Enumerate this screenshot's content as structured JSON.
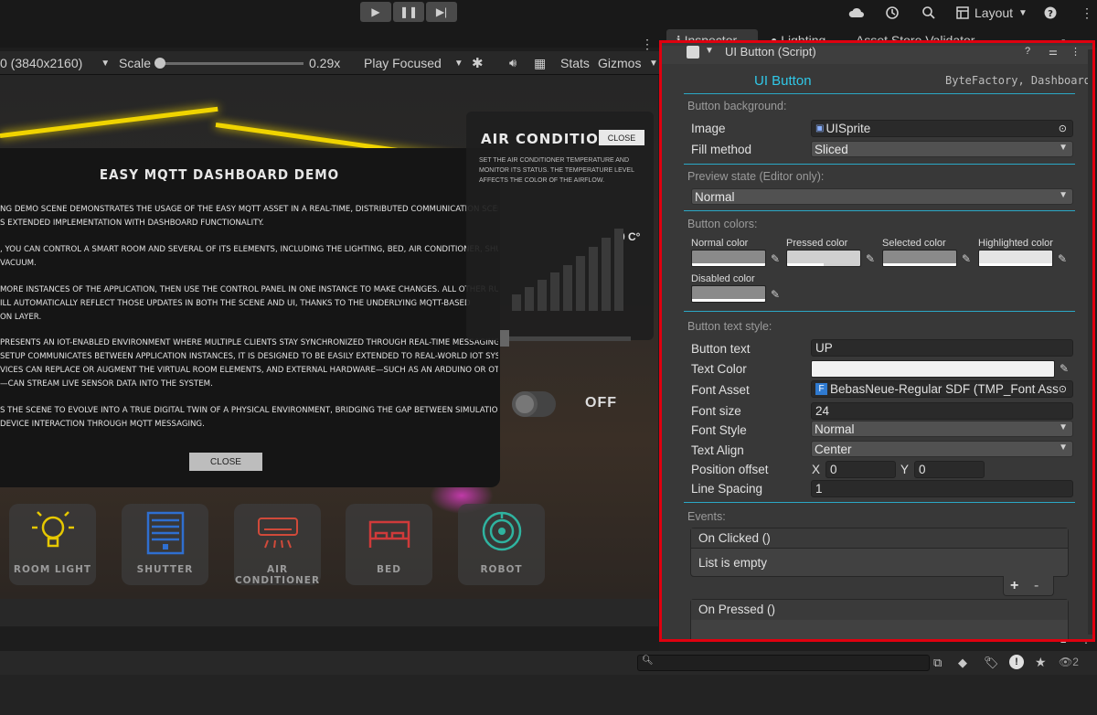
{
  "topbar": {
    "play_icon": "play-icon",
    "pause_icon": "pause-icon",
    "step_icon": "step-icon",
    "layout_label": "Layout"
  },
  "tabs": {
    "inspector": "Inspector",
    "lighting": "Lighting",
    "asset_store": "Asset Store Validator"
  },
  "game_toolbar": {
    "resolution": "0 (3840x2160)",
    "scale_label": "Scale",
    "scale_value": "0.29x",
    "play_mode": "Play Focused",
    "stats": "Stats",
    "gizmos": "Gizmos"
  },
  "game": {
    "dialog_title": "EASY MQTT DASHBOARD DEMO",
    "paragraphs": [
      "ng demo scene demonstrates the usage of the Easy MQTT asset in a real-time, distributed communication scenario,",
      "s extended implementation with dashboard functionality.",
      ", you can control a smart room and several of its elements, including the lighting, bed, air conditioner, shutters,",
      "vacuum.",
      "more instances of the application, then use the control panel in one instance to make changes. All other running",
      "ill automatically reflect those updates in both the scene and UI, thanks to the underlying MQTT-based",
      "on layer.",
      "presents an IoT-enabled environment where multiple clients stay synchronized through real-time messaging. While",
      "setup communicates between application instances, it is designed to be easily extended to real-world IoT systems.",
      "vices can replace or augment the virtual room elements, and external hardware—such as an Arduino or other IoT",
      "—can stream live sensor data into the system.",
      "s the scene to evolve into a true digital twin of a physical environment, bridging the gap between simulation and",
      "device interaction through MQTT messaging."
    ],
    "dialog_close": "CLOSE",
    "ac_title": "AIR CONDITIONER",
    "ac_close": "CLOSE",
    "ac_desc": "Set the air conditioner temperature and monitor its status. The temperature level affects the color of the airflow.",
    "ac_temp": "0 C°",
    "toggle_label": "OFF",
    "dock": [
      {
        "label": "ROOM LIGHT",
        "icon": "lightbulb-icon",
        "color": "#e6c800"
      },
      {
        "label": "SHUTTER",
        "icon": "shutter-icon",
        "color": "#2f6fd0"
      },
      {
        "label": "AIR CONDITIONER",
        "icon": "air-conditioner-icon",
        "color": "#d04a3a"
      },
      {
        "label": "BED",
        "icon": "bed-icon",
        "color": "#d03a3a"
      },
      {
        "label": "ROBOT",
        "icon": "robot-vacuum-icon",
        "color": "#2fb3a0"
      }
    ]
  },
  "inspector": {
    "component_title": "UI Button (Script)",
    "header_title": "UI Button",
    "header_credit": "ByteFactory, Dashboard",
    "sec_background": "Button background:",
    "image_label": "Image",
    "image_value": "UISprite",
    "fill_label": "Fill method",
    "fill_value": "Sliced",
    "sec_preview": "Preview state (Editor only):",
    "preview_value": "Normal",
    "sec_colors": "Button colors:",
    "colors": [
      {
        "label": "Normal color",
        "color": "#8a8a8a"
      },
      {
        "label": "Pressed color",
        "color": "#d0d0d0"
      },
      {
        "label": "Selected color",
        "color": "#8a8a8a"
      },
      {
        "label": "Highlighted color",
        "color": "#e4e4e4"
      },
      {
        "label": "Disabled color",
        "color": "#8a8a8a"
      }
    ],
    "sec_text": "Button text style:",
    "button_text_label": "Button text",
    "button_text_value": "UP",
    "text_color_label": "Text Color",
    "text_color_value": "#f2f2f2",
    "font_asset_label": "Font Asset",
    "font_asset_value": "BebasNeue-Regular SDF (TMP_Font Asse",
    "font_size_label": "Font size",
    "font_size_value": "24",
    "font_style_label": "Font Style",
    "font_style_value": "Normal",
    "text_align_label": "Text Align",
    "text_align_value": "Center",
    "pos_offset_label": "Position offset",
    "pos_x_label": "X",
    "pos_x_value": "0",
    "pos_y_label": "Y",
    "pos_y_value": "0",
    "line_spacing_label": "Line Spacing",
    "line_spacing_value": "1",
    "sec_events": "Events:",
    "event_clicked": "On Clicked ()",
    "event_empty": "List is empty",
    "add_btn": "+",
    "remove_btn": "-",
    "event_pressed": "On Pressed ()"
  },
  "bottom": {
    "badge_count": "2"
  }
}
